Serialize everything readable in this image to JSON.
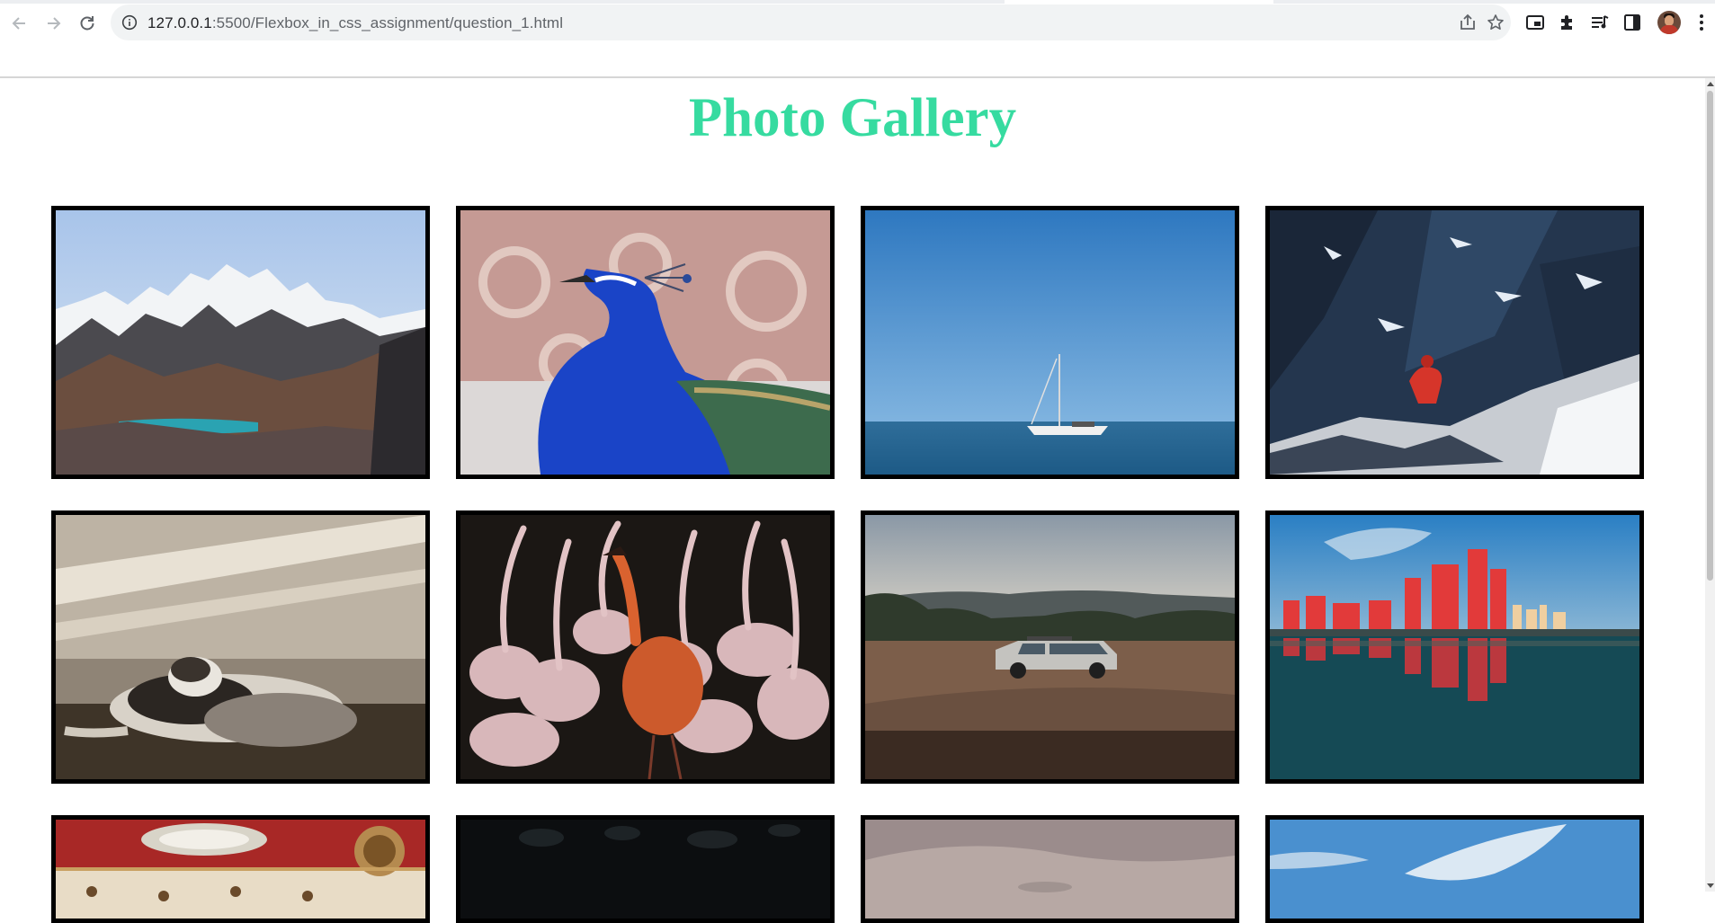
{
  "browser": {
    "url_host": "127.0.0.1",
    "url_path": ":5500/Flexbox_in_css_assignment/question_1.html",
    "icons": {
      "back": "arrow-left-icon",
      "forward": "arrow-right-icon",
      "reload": "reload-icon",
      "site_info": "info-icon",
      "share": "share-icon",
      "bookmark": "star-icon",
      "pip": "picture-in-picture-icon",
      "extensions": "puzzle-icon",
      "reading_list": "reading-list-icon",
      "side_panel": "side-panel-icon",
      "profile": "avatar",
      "menu": "kebab-menu-icon"
    }
  },
  "page": {
    "title": "Photo Gallery",
    "title_color": "#36dba0",
    "border_color": "#000000"
  },
  "gallery": {
    "images": [
      {
        "subject": "snowy mountains with turquoise lake"
      },
      {
        "subject": "blue peacock"
      },
      {
        "subject": "sailboat on the sea"
      },
      {
        "subject": "climber in red on snowy rock"
      },
      {
        "subject": "cat lying in sunlight"
      },
      {
        "subject": "pink and orange flamingos"
      },
      {
        "subject": "suv on dirt road at dusk"
      },
      {
        "subject": "city skyline lit red reflected in water"
      },
      {
        "subject": "ornate painted ceiling"
      },
      {
        "subject": "dark bokeh"
      },
      {
        "subject": "cloudy dusk sky"
      },
      {
        "subject": "blue sky with clouds"
      }
    ]
  }
}
